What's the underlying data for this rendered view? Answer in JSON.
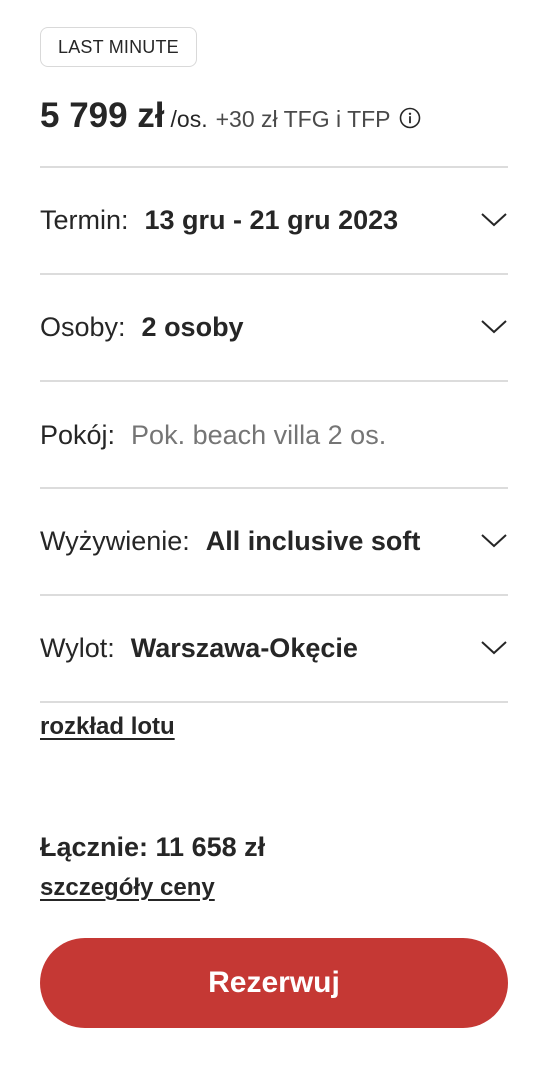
{
  "badge": "LAST MINUTE",
  "price": {
    "amount": "5 799 zł",
    "per": "/os.",
    "extra": "+30 zł TFG i TFP",
    "info_icon": "info-circle-icon"
  },
  "fields": {
    "termin": {
      "label": "Termin:",
      "value": "13 gru - 21 gru 2023"
    },
    "osoby": {
      "label": "Osoby:",
      "value": "2 osoby"
    },
    "pokoj": {
      "label": "Pokój:",
      "value": "Pok. beach villa 2 os."
    },
    "wyzywienie": {
      "label": "Wyżywienie:",
      "value": "All inclusive soft"
    },
    "wylot": {
      "label": "Wylot:",
      "value": "Warszawa-Okęcie"
    }
  },
  "links": {
    "flight_schedule": "rozkład lotu",
    "price_details": "szczegóły ceny"
  },
  "total": "Łącznie: 11 658 zł",
  "book_button": "Rezerwuj",
  "colors": {
    "accent": "#c53834",
    "text": "#262626",
    "muted": "#757575",
    "divider": "#dcdcdc"
  }
}
